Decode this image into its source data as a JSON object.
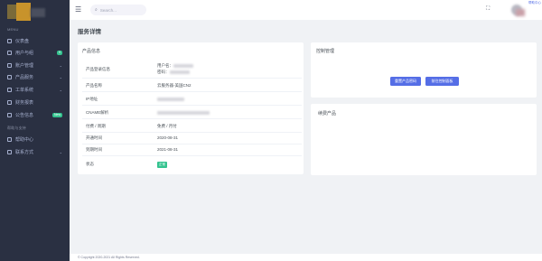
{
  "sidebar": {
    "section_menu": "MENU",
    "section_help": "帮助与支持",
    "items": [
      {
        "label": "仪表盘",
        "has_chevron": false,
        "badge": ""
      },
      {
        "label": "用户与组",
        "has_chevron": false,
        "badge": "9"
      },
      {
        "label": "账户管理",
        "has_chevron": true,
        "badge": ""
      },
      {
        "label": "产品服务",
        "has_chevron": true,
        "badge": ""
      },
      {
        "label": "工单系统",
        "has_chevron": true,
        "badge": ""
      },
      {
        "label": "财务报表",
        "has_chevron": false,
        "badge": ""
      },
      {
        "label": "公告信息",
        "has_chevron": false,
        "badge": "New"
      }
    ],
    "help_items": [
      {
        "label": "帮助中心",
        "has_chevron": false
      },
      {
        "label": "联系方式",
        "has_chevron": true
      }
    ]
  },
  "topbar": {
    "search_placeholder": "Search...",
    "top_link": "帮助中心"
  },
  "page": {
    "title": "服务详情"
  },
  "product_card": {
    "title": "产品信息",
    "rows": [
      {
        "key": "产品登录信息",
        "value": "用户名：",
        "value2": "密码："
      },
      {
        "key": "产品名称",
        "value": "云服务器-美国CN2"
      },
      {
        "key": "IP地址",
        "value": ""
      },
      {
        "key": "CNAME解析",
        "value": ""
      },
      {
        "key": "付费 / 周期",
        "value": "免费 / 月付"
      },
      {
        "key": "开通时间",
        "value": "2020-08-31"
      },
      {
        "key": "到期时间",
        "value": "2021-08-31"
      },
      {
        "key": "状态",
        "value": "",
        "status": "正常"
      }
    ]
  },
  "control_card": {
    "title": "控制管理",
    "btn_login": "重置产品密码",
    "btn_panel": "前往控制面板"
  },
  "related_card": {
    "title": "续费产品"
  },
  "footer": {
    "text": "© Copyright 2020-2021 All Rights Reserved."
  },
  "colors": {
    "sidebar_bg": "#2a3042",
    "primary": "#556ee6",
    "success": "#34c38f",
    "page_bg": "#f0f2f5"
  }
}
